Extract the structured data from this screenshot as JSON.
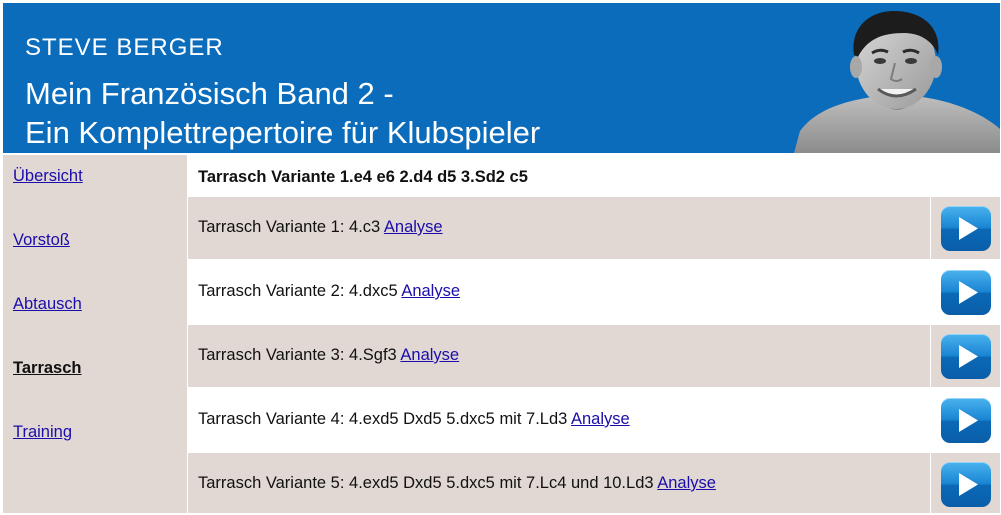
{
  "header": {
    "author": "STEVE BERGER",
    "title_line1": "Mein Französisch Band 2 -",
    "title_line2": "Ein Komplettrepertoire für Klubspieler"
  },
  "sidebar": {
    "items": [
      {
        "label": "Übersicht",
        "active": false
      },
      {
        "label": "Vorstoß",
        "active": false
      },
      {
        "label": "Abtausch",
        "active": false
      },
      {
        "label": "Tarrasch",
        "active": true
      },
      {
        "label": "Training",
        "active": false
      }
    ]
  },
  "main": {
    "heading": "Tarrasch Variante 1.e4 e6 2.d4 d5 3.Sd2 c5",
    "rows": [
      {
        "text": "Tarrasch Variante 1: 4.c3",
        "link": "Analyse",
        "play_icon": "play-icon"
      },
      {
        "text": "Tarrasch Variante 2: 4.dxc5",
        "link": "Analyse",
        "play_icon": "play-icon"
      },
      {
        "text": "Tarrasch Variante 3: 4.Sgf3",
        "link": "Analyse",
        "play_icon": "play-icon"
      },
      {
        "text": "Tarrasch Variante 4: 4.exd5 Dxd5 5.dxc5 mit 7.Ld3",
        "link": "Analyse",
        "play_icon": "play-icon"
      },
      {
        "text": "Tarrasch Variante 5: 4.exd5 Dxd5 5.dxc5 mit 7.Lc4 und 10.Ld3",
        "link": "Analyse",
        "play_icon": "play-icon"
      }
    ]
  },
  "colors": {
    "header_bg": "#0a6cbb",
    "sidebar_bg": "#e1d8d3",
    "link": "#1a0dab",
    "play_button": "#1a86d2"
  }
}
